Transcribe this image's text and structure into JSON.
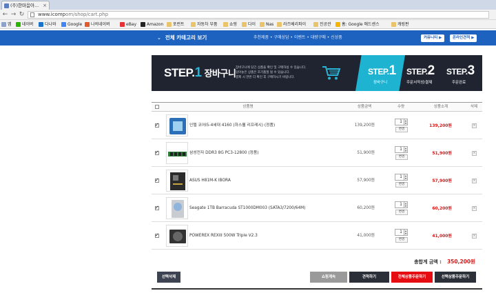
{
  "browser": {
    "tab_title": "(주)한마음아...",
    "url": "www.icomp",
    "url_path": "om/shop/cart.php",
    "bookmarks": [
      "앱",
      "네이버",
      "다나와",
      "Google",
      "나의네이버",
      "eBay",
      "Amazon",
      "포런트",
      "자동차 부품",
      "쇼핑",
      "다이",
      "Nas",
      "라즈베리파이",
      "진공관",
      "홈: Google 애드센스",
      "캐링판"
    ]
  },
  "site": {
    "all_category": "전체 카테고리 보기",
    "links": "추천제품 • 구매상담 • 이벤트 • 대량구매 • 신상품",
    "btn_cs": "커뮤니티 ▶",
    "btn_quote": "온라인견적 ▶"
  },
  "banner": {
    "step_word": "STEP.",
    "step1_num": "1",
    "step1_label": "장바구니",
    "desc": [
      "장바구니에 담긴 상품을 확인 및 구매하실 수 있습니다.",
      "담아놓은 상품은 조기품절 될 수 있습니다.",
      "결제 시 한번 더 확인 후 구매하시기 바랍니다."
    ],
    "steps": [
      {
        "prefix": "STEP.",
        "num": "1",
        "label": "장바구니"
      },
      {
        "prefix": "STEP.",
        "num": "2",
        "label": "주문서작성/결제"
      },
      {
        "prefix": "STEP.",
        "num": "3",
        "label": "주문완료"
      }
    ]
  },
  "table": {
    "headers": {
      "name": "상품명",
      "price": "상품금액",
      "qty": "수량",
      "subtotal": "상품소계",
      "delete": "삭제"
    },
    "change_label": "변경",
    "rows": [
      {
        "name": "인텔 코어i5-4세대 4160 (하스웰 리프레시) (정품)",
        "price": "139,200원",
        "qty": "1",
        "subtotal": "139,200원",
        "checked": true
      },
      {
        "name": "삼성전자 DDR3 8G PC3-12800 (정품)",
        "price": "51,900원",
        "qty": "1",
        "subtotal": "51,900원",
        "checked": true
      },
      {
        "name": "ASUS H81M-K IBORA",
        "price": "57,900원",
        "qty": "1",
        "subtotal": "57,900원",
        "checked": true
      },
      {
        "name": "Seagate 1TB Barracuda ST1000DM003 (SATA3/7200/64M)",
        "price": "60,200원",
        "qty": "1",
        "subtotal": "60,200원",
        "checked": true
      },
      {
        "name": "POWEREX REXIII 500W Triple V2.3",
        "price": "41,000원",
        "qty": "1",
        "subtotal": "41,000원",
        "checked": true
      }
    ]
  },
  "total": {
    "label": "총합계 금액 :",
    "amount": "350,200원"
  },
  "buttons": {
    "delete_selected": "선택삭제",
    "continue": "쇼핑계속",
    "estimate": "견적하기",
    "order_all": "전체상품주문하기",
    "order_selected": "선택상품주문하기"
  },
  "colors": {
    "site_blue": "#1e62c0",
    "step_cyan": "#1fb3d2",
    "price_red": "#d31919",
    "banner_dark": "#1f2430"
  }
}
